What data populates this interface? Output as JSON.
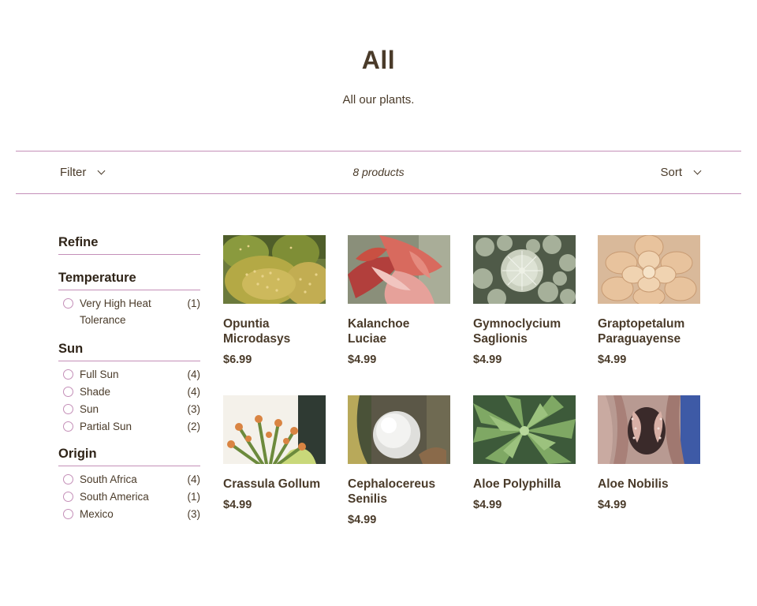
{
  "header": {
    "title": "All",
    "subtitle": "All our plants."
  },
  "toolbar": {
    "filter_label": "Filter",
    "count_text": "8 products",
    "sort_label": "Sort"
  },
  "sidebar": {
    "refine_heading": "Refine",
    "groups": [
      {
        "heading": "Temperature",
        "options": [
          {
            "label": "Very High Heat Tolerance",
            "count": "(1)"
          }
        ]
      },
      {
        "heading": "Sun",
        "options": [
          {
            "label": "Full Sun",
            "count": "(4)"
          },
          {
            "label": "Shade",
            "count": "(4)"
          },
          {
            "label": "Sun",
            "count": "(3)"
          },
          {
            "label": "Partial Sun",
            "count": "(2)"
          }
        ]
      },
      {
        "heading": "Origin",
        "options": [
          {
            "label": "South Africa",
            "count": "(4)"
          },
          {
            "label": "South America",
            "count": "(1)"
          },
          {
            "label": "Mexico",
            "count": "(3)"
          }
        ]
      }
    ]
  },
  "products": [
    {
      "name": "Opuntia Microdasys",
      "price": "$6.99",
      "image": "opuntia-cactus-photo"
    },
    {
      "name": "Kalanchoe Luciae",
      "price": "$4.99",
      "image": "kalanchoe-photo"
    },
    {
      "name": "Gymnoclycium Saglionis",
      "price": "$4.99",
      "image": "gymnocalycium-photo"
    },
    {
      "name": "Graptopetalum Paraguayense",
      "price": "$4.99",
      "image": "graptopetalum-photo"
    },
    {
      "name": "Crassula Gollum",
      "price": "$4.99",
      "image": "crassula-photo"
    },
    {
      "name": "Cephalocereus Senilis",
      "price": "$4.99",
      "image": "cephalocereus-photo"
    },
    {
      "name": "Aloe Polyphilla",
      "price": "$4.99",
      "image": "aloe-polyphylla-photo"
    },
    {
      "name": "Aloe Nobilis",
      "price": "$4.99",
      "image": "aloe-nobilis-photo"
    }
  ],
  "colors": {
    "text": "#4a3b2a",
    "accent_line": "#c48fb8"
  }
}
